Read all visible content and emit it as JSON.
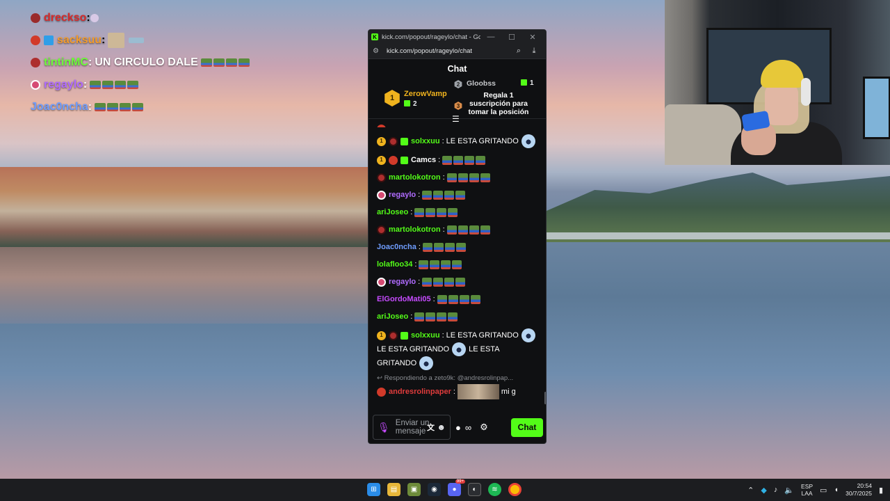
{
  "overlay": {
    "lines": [
      {
        "user": "dreckso",
        "user_color": "#d62b2b",
        "message": "",
        "badge_color": "#9a2b2b"
      },
      {
        "user": "sacksuu",
        "user_color": "#f39c2c",
        "message": "",
        "badge_color": "#d23a2a"
      },
      {
        "user": "tintinMC",
        "user_color": "#6dfb3a",
        "message": "UN CIRCULO DALE",
        "badge_color": "#ad2e2e"
      },
      {
        "user": "regaylo",
        "user_color": "#b06bff",
        "message": "",
        "badge_color": "#d64b73"
      },
      {
        "user": "Joac0ncha",
        "user_color": "#6f9dff",
        "message": "",
        "badge_color": ""
      }
    ]
  },
  "browser": {
    "title": "kick.com/popout/rageylo/chat - Google...",
    "url": "kick.com/popout/rageylo/chat",
    "minimize": "—",
    "maximize": "☐",
    "close": "✕"
  },
  "chat": {
    "header": "Chat",
    "pinned": {
      "top_gifter_rank": "1",
      "top_gifter_name": "ZerowVamp",
      "top_gifter_count": "2",
      "second_rank": "2",
      "second_name": "Gloobss",
      "second_count": "1",
      "third_rank": "3",
      "cta": "Regala 1 suscripción para tomar la posición"
    },
    "messages": [
      {
        "user": "solxxuu",
        "color": "#53fc18",
        "text": "LE ESTA GRITANDO",
        "sub": "1"
      },
      {
        "user": "Camcs",
        "color": "#ffffff",
        "text": "",
        "sub": "1"
      },
      {
        "user": "martolokotron",
        "color": "#53fc18",
        "text": ""
      },
      {
        "user": "regaylo",
        "color": "#b06bff",
        "text": ""
      },
      {
        "user": "ariJoseo",
        "color": "#53fc18",
        "text": ""
      },
      {
        "user": "martolokotron",
        "color": "#53fc18",
        "text": ""
      },
      {
        "user": "Joac0ncha",
        "color": "#6f9dff",
        "text": ""
      },
      {
        "user": "lolafloo34",
        "color": "#53fc18",
        "text": ""
      },
      {
        "user": "regaylo",
        "color": "#b06bff",
        "text": ""
      },
      {
        "user": "ElGordoMati05",
        "color": "#c64bff",
        "text": ""
      },
      {
        "user": "ariJoseo",
        "color": "#53fc18",
        "text": ""
      },
      {
        "user": "solxxuu",
        "color": "#53fc18",
        "text": "LE ESTA GRITANDO",
        "text2": "LE ESTA GRITANDO",
        "text3": "LE ESTA",
        "text4": "GRITANDO",
        "sub": "1"
      }
    ],
    "reply": {
      "context": "Respondiendo a zeto9k: @andresrolinpap...",
      "user": "andresrolinpaper",
      "color": "#e03c3c",
      "text": "mi g"
    },
    "composer": {
      "placeholder": "Enviar un mensaje",
      "send_label": "Chat"
    }
  },
  "taskbar": {
    "lang_top": "ESP",
    "lang_bottom": "LAA",
    "time": "20:54",
    "date": "30/7/2025",
    "discord_badge": "99+"
  },
  "colors": {
    "kick_green": "#53fc18",
    "panel_bg": "#0f1012"
  }
}
